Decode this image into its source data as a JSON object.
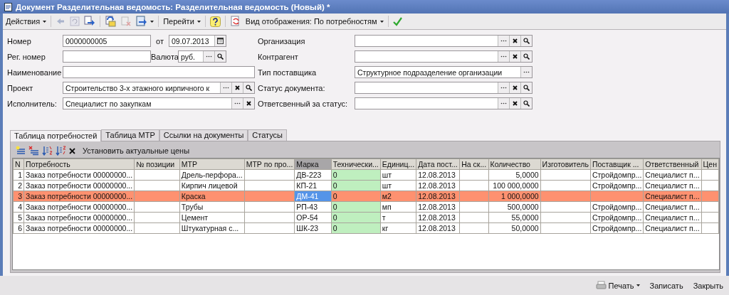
{
  "window": {
    "title": "Документ Разделительная ведомость: Разделительная ведомость (Новый) *"
  },
  "toolbar": {
    "actions_menu": "Действия",
    "goto_menu": "Перейти",
    "view_menu": "Вид отображения: По потребностям"
  },
  "form": {
    "left": [
      {
        "label": "Номер",
        "value": "0000000005",
        "kind": "number",
        "date_label": "от",
        "date": "09.07.2013"
      },
      {
        "label": "Рег. номер",
        "kind": "currency",
        "currency_label": "Валюта",
        "currency": "руб."
      },
      {
        "label": "Наименование",
        "kind": "plain"
      },
      {
        "label": "Проект",
        "value": "Строительство 3-х этажного кирпичного к",
        "kind": "lookup"
      },
      {
        "label": "Исполнитель:",
        "value": "Специалист по закупкам",
        "kind": "choice"
      }
    ],
    "right": [
      {
        "label": "Организация",
        "kind": "lookup"
      },
      {
        "label": "Контрагент",
        "kind": "lookup"
      },
      {
        "label": "Тип поставщика",
        "value": "Структурное подразделение организации",
        "kind": "list"
      },
      {
        "label": "Статус документа:",
        "kind": "lookup"
      },
      {
        "label": "Ответсвенный за статус:",
        "kind": "lookup"
      }
    ]
  },
  "tabs": [
    {
      "label": "Таблица потребностей",
      "selected": true
    },
    {
      "label": "Таблица МТР",
      "selected": false
    },
    {
      "label": "Ссылки на документы",
      "selected": false
    },
    {
      "label": "Статусы",
      "selected": false
    }
  ],
  "table_toolbar": {
    "action": "Установить актуальные цены"
  },
  "table": {
    "columns": [
      {
        "title": "N",
        "kind": "index",
        "current": false
      },
      {
        "title": "Потребность",
        "kind": "text",
        "current": false
      },
      {
        "title": "№ позиции",
        "kind": "text",
        "current": false
      },
      {
        "title": "МТР",
        "kind": "text",
        "current": false
      },
      {
        "title": "МТР по про...",
        "kind": "text",
        "current": false
      },
      {
        "title": "Марка",
        "kind": "text",
        "current": true
      },
      {
        "title": "Технически...",
        "kind": "marked",
        "current": false
      },
      {
        "title": "Единиц...",
        "kind": "text",
        "current": false
      },
      {
        "title": "Дата пост...",
        "kind": "text",
        "current": false
      },
      {
        "title": "На ск...",
        "kind": "text",
        "current": false
      },
      {
        "title": "Количество",
        "kind": "number",
        "current": false
      },
      {
        "title": "Изготовитель",
        "kind": "text",
        "current": false
      },
      {
        "title": "Поставщик ...",
        "kind": "text",
        "current": false
      },
      {
        "title": "Ответственный",
        "kind": "text",
        "current": false
      },
      {
        "title": "Цен",
        "kind": "text",
        "current": false
      }
    ],
    "rows": [
      {
        "selected": false,
        "cells": [
          "1",
          "Заказ потребности 00000000...",
          "",
          "Дрель-перфора...",
          "",
          "ДВ-223",
          "0",
          "шт",
          "12.08.2013",
          "",
          "5,0000",
          "",
          "Стройдомпр...",
          "Специалист п...",
          ""
        ]
      },
      {
        "selected": false,
        "cells": [
          "2",
          "Заказ потребности 00000000...",
          "",
          "Кирпич лицевой",
          "",
          "КП-21",
          "0",
          "шт",
          "12.08.2013",
          "",
          "100 000,0000",
          "",
          "Стройдомпр...",
          "Специалист п...",
          ""
        ]
      },
      {
        "selected": true,
        "cells": [
          "3",
          "Заказ потребности 00000000...",
          "",
          "Краска",
          "",
          "ДМ-41",
          "0",
          "м2",
          "12.08.2013",
          "",
          "1 000,0000",
          "",
          "",
          "Специалист п...",
          ""
        ]
      },
      {
        "selected": false,
        "cells": [
          "4",
          "Заказ потребности 00000000...",
          "",
          "Трубы",
          "",
          "РП-43",
          "0",
          "мп",
          "12.08.2013",
          "",
          "500,0000",
          "",
          "Стройдомпр...",
          "Специалист п...",
          ""
        ]
      },
      {
        "selected": false,
        "cells": [
          "5",
          "Заказ потребности 00000000...",
          "",
          "Цемент",
          "",
          "ОР-54",
          "0",
          "т",
          "12.08.2013",
          "",
          "55,0000",
          "",
          "Стройдомпр...",
          "Специалист п...",
          ""
        ]
      },
      {
        "selected": false,
        "cells": [
          "6",
          "Заказ потребности 00000000...",
          "",
          "Штукатурная с...",
          "",
          "ШК-23",
          "0",
          "кг",
          "12.08.2013",
          "",
          "50,0000",
          "",
          "Стройдомпр...",
          "Специалист п...",
          ""
        ]
      }
    ]
  },
  "bottom_bar": {
    "print": "Печать",
    "save": "Записать",
    "close": "Закрыть"
  }
}
